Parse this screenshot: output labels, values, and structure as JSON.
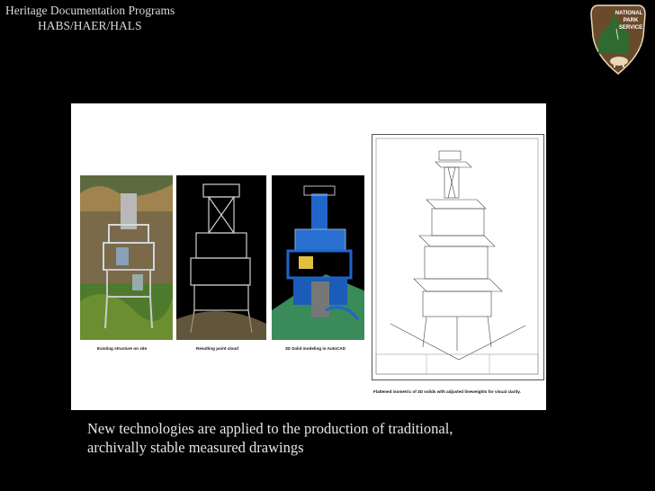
{
  "header": {
    "line1": "Heritage Documentation Programs",
    "line2": "HABS/HAER/HALS"
  },
  "logo": {
    "name": "nps-arrowhead-icon",
    "lines": [
      "NATIONAL",
      "PARK",
      "SERVICE"
    ]
  },
  "figure": {
    "captions": [
      "Existing structure on site",
      "Resulting point cloud",
      "3D Solid modeling in AutoCAD",
      "Flattened isometric of 3D solids with adjusted lineweights for visual clarity."
    ]
  },
  "body": {
    "line1": "New technologies are applied to the production of traditional,",
    "line2": "archivally stable measured drawings"
  },
  "colors": {
    "background": "#000000",
    "nps_brown": "#6b4a2b",
    "model_blue": "#1f66c8",
    "model_green": "#3a8a5a"
  }
}
